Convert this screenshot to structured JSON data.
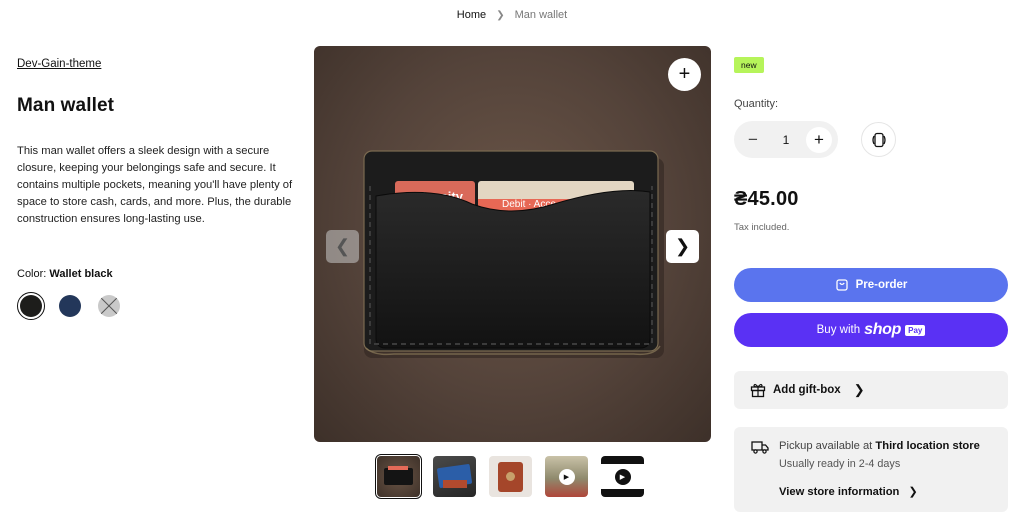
{
  "breadcrumb": {
    "home": "Home",
    "current": "Man wallet"
  },
  "product": {
    "vendor": "Dev-Gain-theme",
    "title": "Man wallet",
    "description": "This man wallet offers a sleek design with a secure closure, keeping your belongings safe and secure. It contains multiple pockets, meaning you'll have plenty of space to store cash, cards, and more. Plus, the durable construction ensures long-lasting use.",
    "color_label": "Color:",
    "color_value": "Wallet black",
    "swatches": [
      {
        "name": "Wallet black",
        "color": "#1d1d1b",
        "selected": true
      },
      {
        "name": "Navy",
        "color": "#23375a",
        "selected": false
      },
      {
        "name": "Unavailable",
        "color": "#c9c9c9",
        "selected": false
      }
    ]
  },
  "gallery": {
    "card_text_left": "Uancity",
    "card_text_right": "Debit · Acce",
    "thumbnail_count": 5
  },
  "badge": "new",
  "quantity": {
    "label": "Quantity:",
    "value": "1",
    "minus": "−",
    "plus": "+"
  },
  "price": "₴45.00",
  "tax_note": "Tax included.",
  "buttons": {
    "preorder": "Pre-order",
    "buy_with": "Buy with",
    "shop": "shop",
    "pay": "Pay"
  },
  "gift": {
    "label": "Add gift-box"
  },
  "pickup": {
    "prefix": "Pickup available at",
    "store": "Third location store",
    "ready": "Usually ready in 2-4 days",
    "link": "View store information"
  },
  "colors": {
    "accent_blue": "#5a74ee",
    "shop_purple": "#5a31f4",
    "badge_green": "#b6f45a"
  }
}
